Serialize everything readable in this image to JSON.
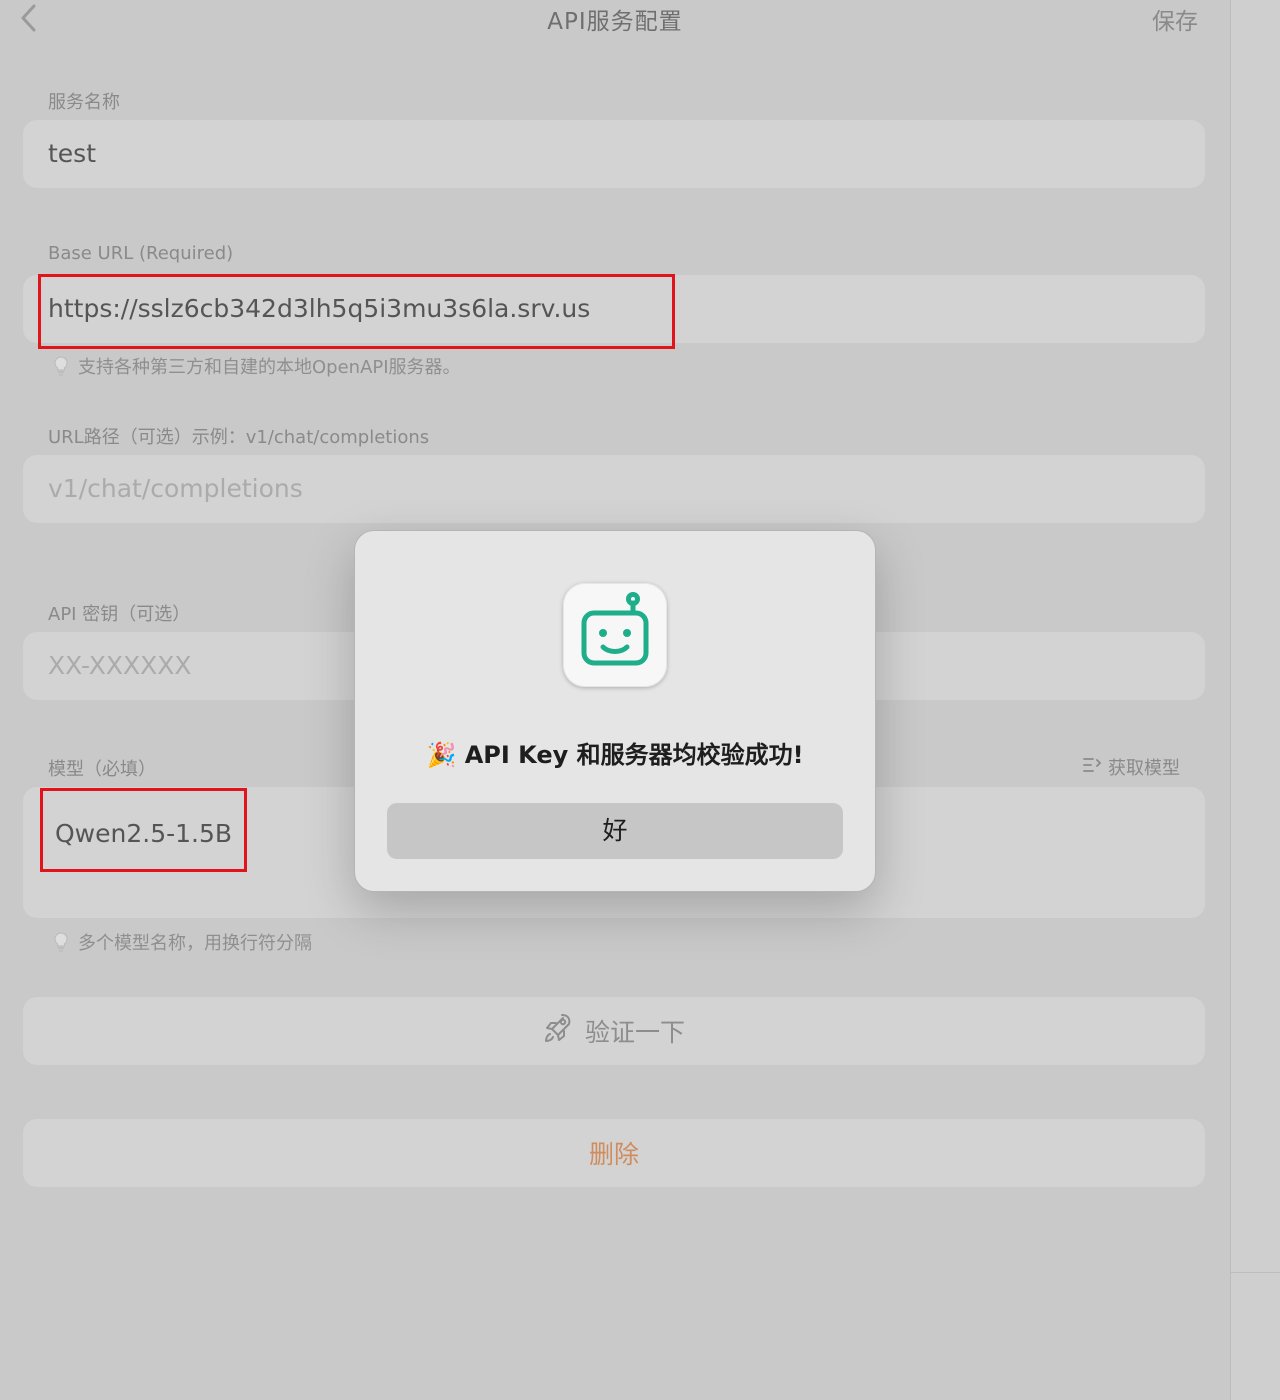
{
  "header": {
    "title": "API服务配置",
    "save_label": "保存"
  },
  "form": {
    "service_name": {
      "label": "服务名称",
      "value": "test"
    },
    "base_url": {
      "label": "Base URL (Required)",
      "value": "https://sslz6cb342d3lh5q5i3mu3s6la.srv.us",
      "hint": "支持各种第三方和自建的本地OpenAPI服务器。"
    },
    "url_path": {
      "label": "URL路径（可选）示例：v1/chat/completions",
      "placeholder": "v1/chat/completions"
    },
    "api_key": {
      "label": "API 密钥（可选）",
      "placeholder": "XX-XXXXXX"
    },
    "model": {
      "label": "模型（必填）",
      "fetch_label": "获取模型",
      "value": "Qwen2.5-1.5B",
      "hint": "多个模型名称，用换行符分隔"
    }
  },
  "actions": {
    "verify_label": "验证一下",
    "delete_label": "删除"
  },
  "dialog": {
    "emoji": "🎉",
    "message": "API Key 和服务器均校验成功!",
    "ok_label": "好"
  },
  "colors": {
    "accent_red": "#e0141a",
    "icon_teal": "#1fae8a",
    "delete_orange": "#cf8c5e"
  },
  "icons": [
    "chevron-left-icon",
    "lightbulb-icon",
    "list-filter-icon",
    "rocket-icon",
    "robot-app-icon",
    "party-popper-icon"
  ]
}
